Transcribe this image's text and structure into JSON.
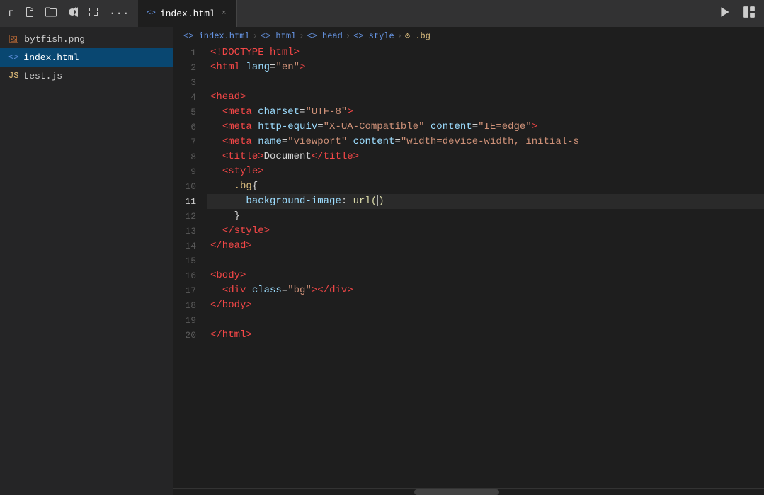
{
  "titleBar": {
    "icons": [
      {
        "name": "e-icon",
        "label": "E"
      },
      {
        "name": "new-file-icon",
        "label": "⬜"
      },
      {
        "name": "new-folder-icon",
        "label": "⬛"
      },
      {
        "name": "refresh-icon",
        "label": "↺"
      },
      {
        "name": "collapse-icon",
        "label": "⧉"
      },
      {
        "name": "more-icon",
        "label": "···"
      }
    ],
    "tab": {
      "label": "index.html",
      "close": "×"
    },
    "runLabel": "▷",
    "layoutLabel": "⊞"
  },
  "breadcrumb": {
    "items": [
      "index.html",
      "html",
      "head",
      "style",
      ".bg"
    ]
  },
  "sidebar": {
    "items": [
      {
        "label": "bytfish.png",
        "type": "png"
      },
      {
        "label": "index.html",
        "type": "html",
        "active": true
      },
      {
        "label": "test.js",
        "type": "js"
      }
    ]
  },
  "editor": {
    "lines": [
      {
        "num": 1,
        "content": "<!DOCTYPE html>"
      },
      {
        "num": 2,
        "content": "<html lang=\"en\">"
      },
      {
        "num": 3,
        "content": ""
      },
      {
        "num": 4,
        "content": "<head>"
      },
      {
        "num": 5,
        "content": "  <meta charset=\"UTF-8\">"
      },
      {
        "num": 6,
        "content": "  <meta http-equiv=\"X-UA-Compatible\" content=\"IE=edge\">"
      },
      {
        "num": 7,
        "content": "  <meta name=\"viewport\" content=\"width=device-width, initial-s"
      },
      {
        "num": 8,
        "content": "  <title>Document</title>"
      },
      {
        "num": 9,
        "content": "  <style>"
      },
      {
        "num": 10,
        "content": "    .bg{"
      },
      {
        "num": 11,
        "content": "      background-image: url()",
        "highlight": true
      },
      {
        "num": 12,
        "content": "    }"
      },
      {
        "num": 13,
        "content": "  </style>"
      },
      {
        "num": 14,
        "content": "</head>"
      },
      {
        "num": 15,
        "content": ""
      },
      {
        "num": 16,
        "content": "<body>"
      },
      {
        "num": 17,
        "content": "  <div class=\"bg\"></div>"
      },
      {
        "num": 18,
        "content": "</body>"
      },
      {
        "num": 19,
        "content": ""
      },
      {
        "num": 20,
        "content": "</html>"
      }
    ]
  }
}
